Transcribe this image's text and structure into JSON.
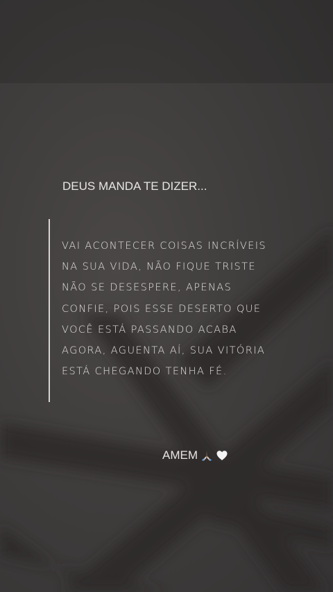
{
  "story": {
    "heading": "DEUS MANDA TE DIZER...",
    "quote": "VAI ACONTECER COISAS INCRÍVEIS NA SUA VIDA, NÃO FIQUE TRISTE NÃO SE DESESPERE, APENAS CONFIE, POIS ESSE DESERTO QUE VOCÊ ESTÁ PASSANDO ACABA AGORA, AGUENTA AÍ, SUA VITÓRIA ESTÁ CHEGANDO TENHA FÉ.",
    "closing": "AMEM",
    "closing_icons": [
      "praying-hands-icon",
      "white-heart-icon"
    ]
  },
  "colors": {
    "background": "#403e3d",
    "text": "#e6e4e2",
    "quote_bar": "#d8d6d4"
  }
}
